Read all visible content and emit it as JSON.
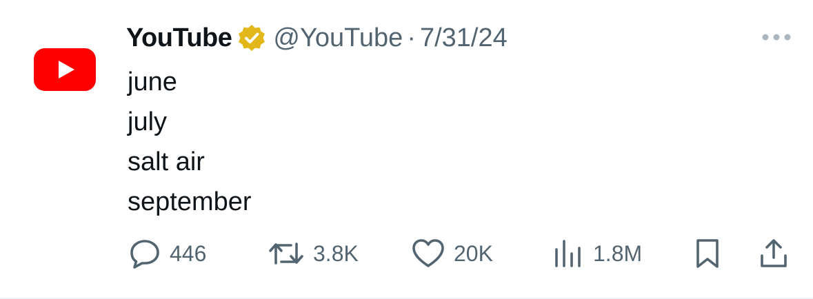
{
  "author": {
    "display_name": "YouTube",
    "handle": "@YouTube",
    "separator": "·",
    "date": "7/31/24",
    "avatar_icon": "youtube-logo-icon",
    "verified_icon": "gold-verified-badge-icon"
  },
  "tweet": {
    "lines": [
      "june",
      "july",
      "salt air",
      "september"
    ]
  },
  "actions": {
    "replies": {
      "icon": "reply-bubble-icon",
      "count": "446"
    },
    "reposts": {
      "icon": "repost-icon",
      "count": "3.8K"
    },
    "likes": {
      "icon": "heart-icon",
      "count": "20K"
    },
    "views": {
      "icon": "analytics-bars-icon",
      "count": "1.8M"
    },
    "bookmark": {
      "icon": "bookmark-icon"
    },
    "share": {
      "icon": "share-icon"
    }
  },
  "menu": {
    "icon": "more-dots-icon"
  },
  "colors": {
    "text_primary": "#0f1419",
    "text_secondary": "#536471",
    "brand_red": "#ff0000",
    "verified_gold": "#e2b719",
    "more_dots": "#aab8c2"
  }
}
